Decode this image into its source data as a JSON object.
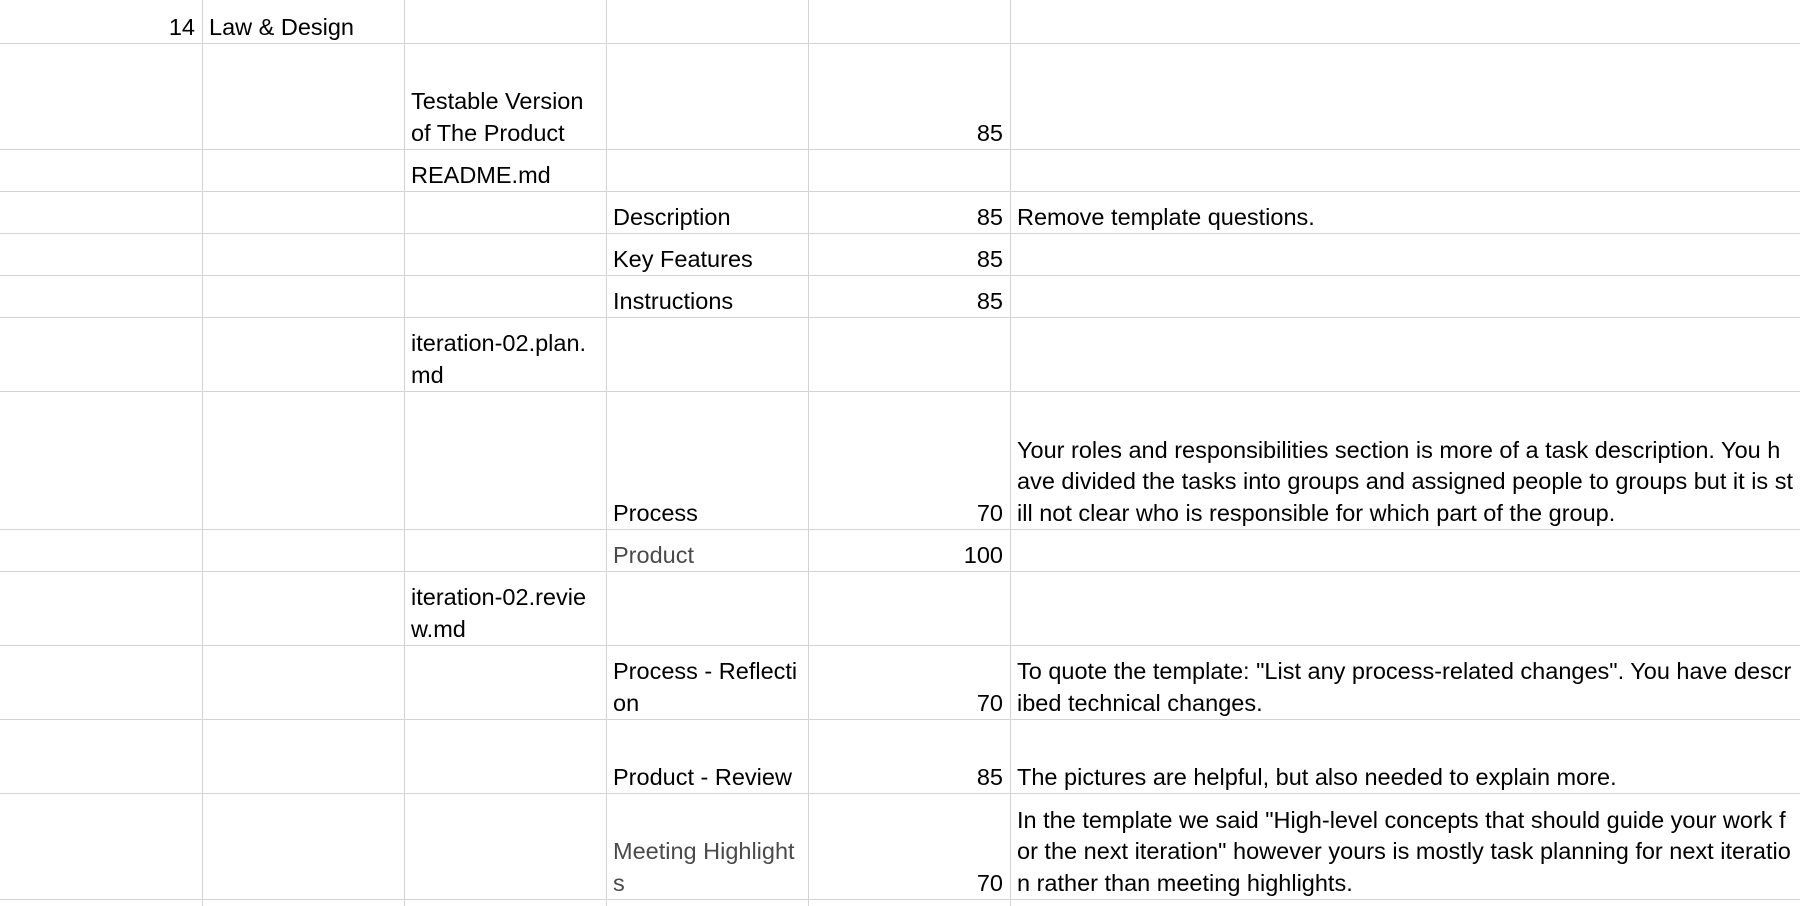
{
  "sheet": {
    "rows": [
      {
        "key": "r0",
        "c0": "14",
        "c1": "Law & Design",
        "c2": "",
        "c3": "",
        "c4": "",
        "c5": ""
      },
      {
        "key": "r1",
        "c0": "",
        "c1": "",
        "c2": "Testable Version of The Product",
        "c3": "",
        "c4": "85",
        "c5": ""
      },
      {
        "key": "r2",
        "c0": "",
        "c1": "",
        "c2": "README.md",
        "c3": "",
        "c4": "",
        "c5": ""
      },
      {
        "key": "r3",
        "c0": "",
        "c1": "",
        "c2": "",
        "c3": "Description",
        "c4": "85",
        "c5": "Remove template questions."
      },
      {
        "key": "r4",
        "c0": "",
        "c1": "",
        "c2": "",
        "c3": "Key Features",
        "c4": "85",
        "c5": ""
      },
      {
        "key": "r5",
        "c0": "",
        "c1": "",
        "c2": "",
        "c3": "Instructions",
        "c4": "85",
        "c5": ""
      },
      {
        "key": "r6",
        "c0": "",
        "c1": "",
        "c2": "iteration-02.plan.md",
        "c3": "",
        "c4": "",
        "c5": ""
      },
      {
        "key": "r7",
        "c0": "",
        "c1": "",
        "c2": "",
        "c3": "Process",
        "c4": "70",
        "c5": "Your roles and responsibilities section is more of a task description. You have divided the tasks into groups and assigned people to groups but it is still not clear who is responsible for which part of the group."
      },
      {
        "key": "r8",
        "c0": "",
        "c1": "",
        "c2": "",
        "c3": "Product",
        "c4": "100",
        "c5": ""
      },
      {
        "key": "r9",
        "c0": "",
        "c1": "",
        "c2": "iteration-02.review.md",
        "c3": "",
        "c4": "",
        "c5": ""
      },
      {
        "key": "r10",
        "c0": "",
        "c1": "",
        "c2": "",
        "c3": "Process - Reflection",
        "c4": "70",
        "c5": "To quote the template: \"List any process-related changes\". You have described technical changes."
      },
      {
        "key": "r11",
        "c0": "",
        "c1": "",
        "c2": "",
        "c3": "Product - Review",
        "c4": "85",
        "c5": "The pictures are helpful, but also needed to explain more."
      },
      {
        "key": "r12",
        "c0": "",
        "c1": "",
        "c2": "",
        "c3": "Meeting Highlights",
        "c4": "70",
        "c5": "In the template we said \"High-level concepts that should guide your work for the next iteration\" however yours is mostly task planning for next iteration rather than meeting highlights."
      }
    ]
  }
}
